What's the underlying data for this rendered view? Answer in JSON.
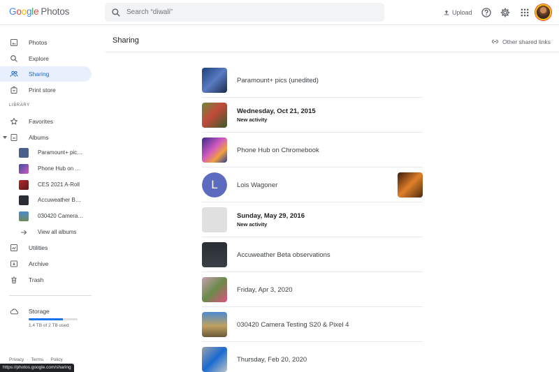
{
  "header": {
    "logo_google": [
      "G",
      "o",
      "o",
      "g",
      "l",
      "e"
    ],
    "logo_photos": "Photos",
    "search_placeholder": "Search “diwali”",
    "upload_label": "Upload"
  },
  "sidebar": {
    "nav": [
      {
        "label": "Photos",
        "icon": "photos-icon"
      },
      {
        "label": "Explore",
        "icon": "search-icon"
      },
      {
        "label": "Sharing",
        "icon": "people-icon",
        "active": true
      },
      {
        "label": "Print store",
        "icon": "store-icon"
      }
    ],
    "library_label": "LIBRARY",
    "library": [
      {
        "label": "Favorites",
        "icon": "star-icon"
      },
      {
        "label": "Albums",
        "icon": "album-icon"
      }
    ],
    "albums": [
      {
        "label": "Paramount+ pics (unedited)",
        "color": "#4a5f8a"
      },
      {
        "label": "Phone Hub on Chromebook",
        "color": "#3d4ea0"
      },
      {
        "label": "CES 2021 A-Roll",
        "color": "#b22a2a"
      },
      {
        "label": "Accuweather Beta observations",
        "color": "#2a2e34"
      },
      {
        "label": "030420 Camera Testing S20 & Pixel 4",
        "color": "#6f8a5a"
      }
    ],
    "view_all": "View all albums",
    "more": [
      {
        "label": "Utilities",
        "icon": "utilities-icon"
      },
      {
        "label": "Archive",
        "icon": "archive-icon"
      },
      {
        "label": "Trash",
        "icon": "trash-icon"
      }
    ],
    "storage_label": "Storage",
    "storage_used": "1.4 TB of 2 TB used",
    "storage_fraction": 0.7,
    "footer": [
      "Privacy",
      "·",
      "Terms",
      "·",
      "Policy"
    ],
    "url_tooltip": "https://photos.google.com/sharing"
  },
  "main": {
    "title": "Sharing",
    "other_links": "Other shared links",
    "rows": [
      {
        "kind": "album",
        "title": "Paramount+ pics (unedited)",
        "thumb": "linear-gradient(135deg,#1c3f7a,#5a7bc2 50%,#1a2a4a)"
      },
      {
        "kind": "date",
        "title": "Wednesday, Oct 21, 2015",
        "sub": "New activity",
        "thumb": "linear-gradient(135deg,#6b8a3a,#c24a3a 45%,#3a5a2a)"
      },
      {
        "kind": "album",
        "title": "Phone Hub on Chromebook",
        "thumb": "linear-gradient(135deg,#3a2a8a,#d05ac0 45%,#f0a040 70%,#2a3a9a)"
      },
      {
        "kind": "person",
        "title": "Lois Wagoner",
        "letter": "L",
        "right_thumb": "linear-gradient(135deg,#3a1a0a,#e0802a 50%,#4a2a10)"
      },
      {
        "kind": "date",
        "title": "Sunday, May 29, 2016",
        "sub": "New activity",
        "thumb": "#e0e0e0"
      },
      {
        "kind": "album",
        "title": "Accuweather Beta observations",
        "thumb": "linear-gradient(180deg,#2a2e34,#3a3f47)"
      },
      {
        "kind": "album",
        "title": "Friday, Apr 3, 2020",
        "thumb": "linear-gradient(135deg,#c8a0b0,#6a8a4a 50%,#e05080)"
      },
      {
        "kind": "album",
        "title": "030420 Camera Testing S20 & Pixel 4",
        "thumb": "linear-gradient(180deg,#4a8ad0,#c0a060 55%,#6a5a3a)"
      },
      {
        "kind": "album",
        "title": "Thursday, Feb 20, 2020",
        "thumb": "linear-gradient(135deg,#9aa0a8,#1a6ad0 50%,#c0c4c8)"
      }
    ]
  }
}
